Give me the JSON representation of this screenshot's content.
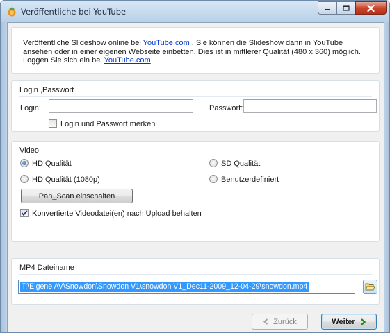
{
  "window": {
    "title": "Veröffentliche bei YouTube",
    "icons": {
      "app": "app-logo-icon",
      "minimize": "minimize-icon",
      "maximize": "maximize-icon",
      "close": "close-icon"
    }
  },
  "intro": {
    "part1": "Veröffentliche Slideshow online bei ",
    "link1": "YouTube.com",
    "part2": " . Sie können die Slideshow dann in YouTube ansehen oder in einer eigenen Webseite einbetten. Dies ist in mittlerer Qualität (480 x 360) möglich. Loggen Sie sich ein bei ",
    "link2": "YouTube.com",
    "part3": " ."
  },
  "login": {
    "group_title": "Login ,Passwort",
    "login_label": "Login:",
    "login_value": "",
    "password_label": "Passwort:",
    "password_value": "",
    "remember_label": "Login und Passwort merken",
    "remember_checked": false
  },
  "video": {
    "group_title": "Video",
    "options": [
      {
        "label": "HD Qualität",
        "selected": true
      },
      {
        "label": "SD Qualität",
        "selected": false
      },
      {
        "label": "HD Qualität (1080p)",
        "selected": false
      },
      {
        "label": "Benutzerdefiniert",
        "selected": false
      }
    ],
    "panscan_button": "Pan_Scan einschalten",
    "keep_label": "Konvertierte Videodatei(en) nach Upload behalten",
    "keep_checked": true
  },
  "mp4": {
    "group_title": "MP4 Dateiname",
    "filename": "T:\\Eigene AV\\Snowdon\\Snowdon V1\\snowdon V1_Dec11-2009_12-04-29\\snowdon.mp4",
    "browse_icon": "folder-open-icon"
  },
  "footer": {
    "back_label": "Zurück",
    "back_icon": "chevron-left-icon",
    "next_label": "Weiter",
    "next_icon": "chevron-right-icon",
    "accent_color": "#1e8f1e"
  }
}
